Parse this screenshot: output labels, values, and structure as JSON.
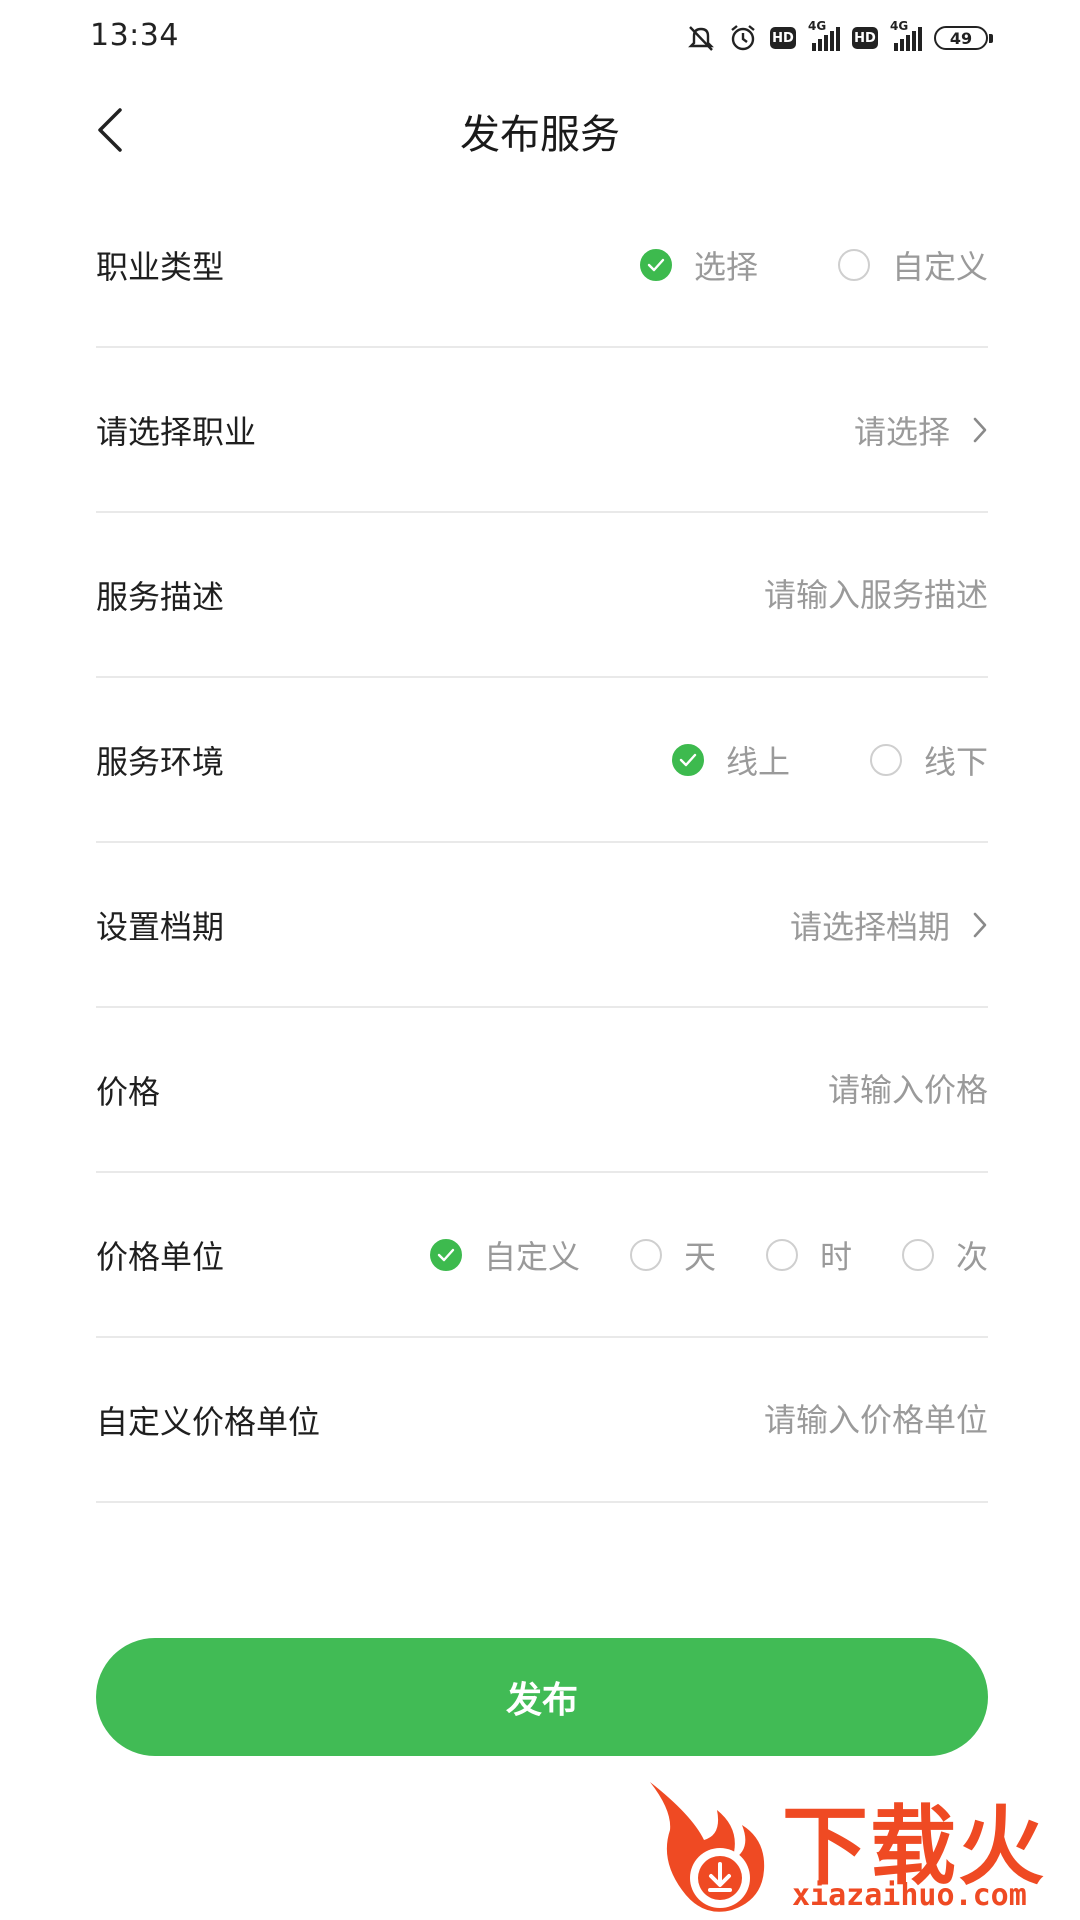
{
  "status_bar": {
    "time": "13:34",
    "battery": "49",
    "network_1": "4G",
    "network_2": "4G",
    "hd_label": "HD"
  },
  "header": {
    "title": "发布服务"
  },
  "form": {
    "occupation_type": {
      "label": "职业类型",
      "options": [
        "选择",
        "自定义"
      ],
      "selected": "选择"
    },
    "occupation": {
      "label": "请选择职业",
      "value": "请选择"
    },
    "description": {
      "label": "服务描述",
      "placeholder": "请输入服务描述"
    },
    "environment": {
      "label": "服务环境",
      "options": [
        "线上",
        "线下"
      ],
      "selected": "线上"
    },
    "schedule": {
      "label": "设置档期",
      "value": "请选择档期"
    },
    "price": {
      "label": "价格",
      "placeholder": "请输入价格"
    },
    "price_unit": {
      "label": "价格单位",
      "options": [
        "自定义",
        "天",
        "时",
        "次"
      ],
      "selected": "自定义"
    },
    "custom_price_unit": {
      "label": "自定义价格单位",
      "placeholder": "请输入价格单位"
    }
  },
  "publish_button": {
    "label": "发布"
  },
  "watermark": {
    "brand": "下载火",
    "url": "xiazaihuo.com"
  },
  "colors": {
    "accent": "#41bb55",
    "placeholder": "#9a9a9a",
    "divider": "#e9e9e9",
    "watermark": "#ef4a23"
  }
}
